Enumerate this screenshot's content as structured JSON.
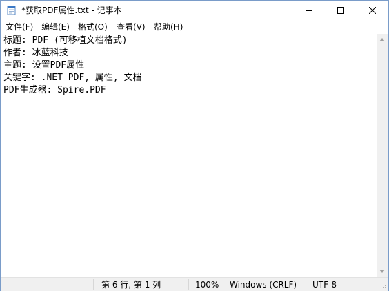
{
  "window": {
    "title": "*获取PDF属性.txt - 记事本",
    "controls": {
      "minimize_icon": "minimize-icon",
      "maximize_icon": "maximize-icon",
      "close_icon": "close-icon"
    }
  },
  "menu": {
    "items": [
      {
        "label": "文件(F)"
      },
      {
        "label": "编辑(E)"
      },
      {
        "label": "格式(O)"
      },
      {
        "label": "查看(V)"
      },
      {
        "label": "帮助(H)"
      }
    ]
  },
  "editor": {
    "lines": [
      "标题: PDF (可移植文档格式)",
      "作者: 冰蓝科技",
      "主题: 设置PDF属性",
      "关键字: .NET PDF, 属性, 文档",
      "PDF生成器: Spire.PDF"
    ]
  },
  "status": {
    "position": "第 6 行, 第 1 列",
    "zoom": "100%",
    "line_ending": "Windows (CRLF)",
    "encoding": "UTF-8"
  },
  "colors": {
    "window_border": "#7a9cc9",
    "statusbar_bg": "#f0f0f0",
    "icon_blue": "#3b79c6"
  }
}
